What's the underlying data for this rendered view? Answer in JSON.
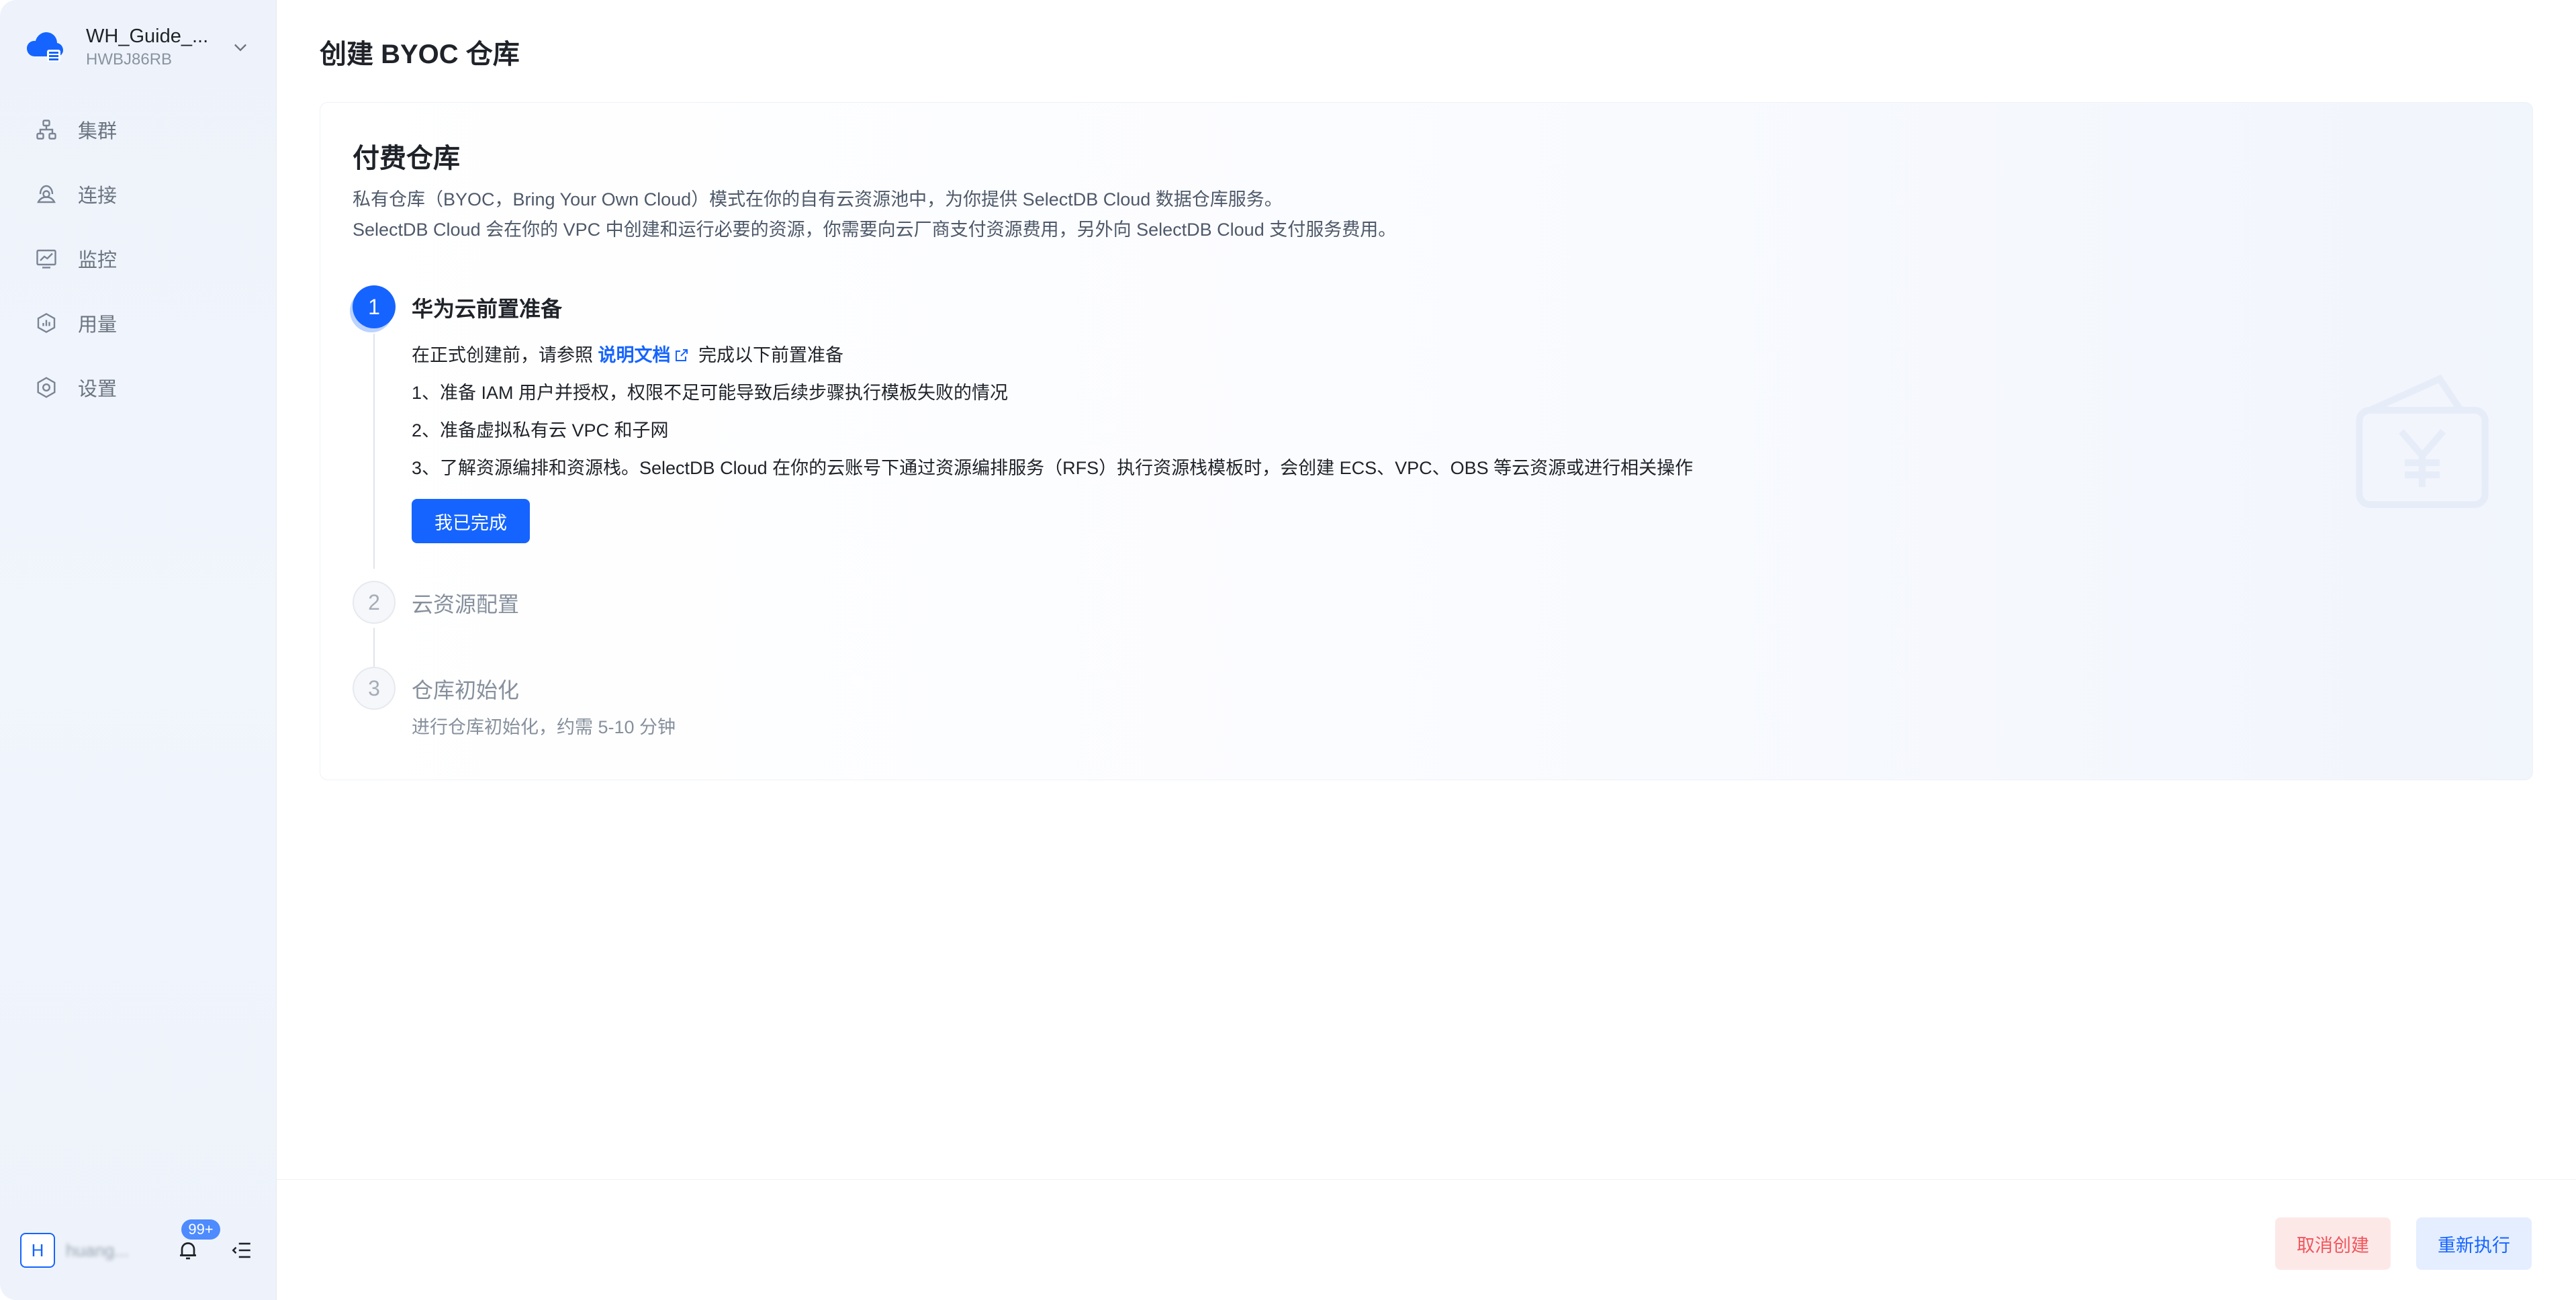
{
  "workspace": {
    "name": "WH_Guide_...",
    "id": "HWBJ86RB"
  },
  "sidebar": {
    "items": [
      {
        "label": "集群",
        "icon": "cluster-icon"
      },
      {
        "label": "连接",
        "icon": "connect-icon"
      },
      {
        "label": "监控",
        "icon": "monitor-icon"
      },
      {
        "label": "用量",
        "icon": "usage-icon"
      },
      {
        "label": "设置",
        "icon": "settings-icon"
      }
    ],
    "user_initial": "H",
    "user_name": "huang...",
    "notification_count": "99+"
  },
  "page": {
    "title": "创建 BYOC 仓库"
  },
  "card": {
    "title": "付费仓库",
    "desc_line1": "私有仓库（BYOC，Bring Your Own Cloud）模式在你的自有云资源池中，为你提供 SelectDB Cloud 数据仓库服务。",
    "desc_line2": "SelectDB Cloud 会在你的 VPC 中创建和运行必要的资源，你需要向云厂商支付资源费用，另外向 SelectDB Cloud 支付服务费用。"
  },
  "steps": [
    {
      "number": "1",
      "title": "华为云前置准备",
      "intro_prefix": "在正式创建前，请参照",
      "doc_link": "说明文档",
      "intro_suffix": "完成以下前置准备",
      "items": [
        "1、准备 IAM 用户并授权，权限不足可能导致后续步骤执行模板失败的情况",
        "2、准备虚拟私有云 VPC 和子网",
        "3、了解资源编排和资源栈。SelectDB Cloud 在你的云账号下通过资源编排服务（RFS）执行资源栈模板时，会创建 ECS、VPC、OBS 等云资源或进行相关操作"
      ],
      "button": "我已完成"
    },
    {
      "number": "2",
      "title": "云资源配置"
    },
    {
      "number": "3",
      "title": "仓库初始化",
      "subtitle": "进行仓库初始化，约需 5-10 分钟"
    }
  ],
  "footer": {
    "cancel": "取消创建",
    "retry": "重新执行"
  },
  "colors": {
    "primary": "#1664ff",
    "danger": "#f0555b",
    "sidebar_bg": "#eef3fb"
  }
}
